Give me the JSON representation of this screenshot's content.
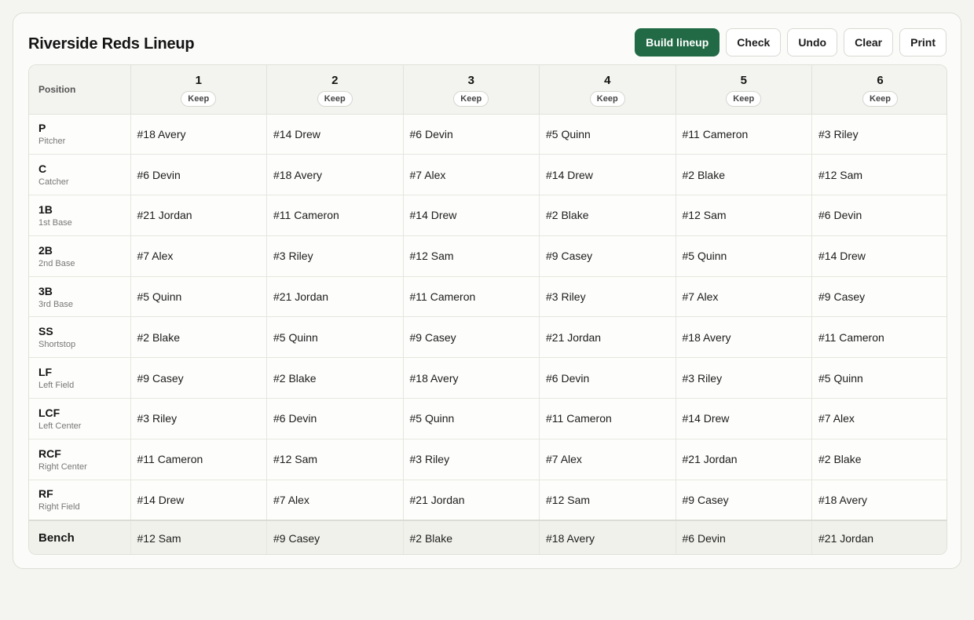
{
  "title": "Riverside Reds Lineup",
  "toolbar": {
    "build": "Build lineup",
    "check": "Check",
    "undo": "Undo",
    "clear": "Clear",
    "print": "Print"
  },
  "colors": {
    "accent": "#226a45",
    "background": "#f4f4f0"
  },
  "table": {
    "position_header": "Position",
    "keep_label": "Keep",
    "innings": [
      "1",
      "2",
      "3",
      "4",
      "5",
      "6"
    ],
    "rows": [
      {
        "code": "P",
        "name": "Pitcher",
        "players": [
          "#18 Avery",
          "#14 Drew",
          "#6 Devin",
          "#5 Quinn",
          "#11 Cameron",
          "#3 Riley"
        ]
      },
      {
        "code": "C",
        "name": "Catcher",
        "players": [
          "#6 Devin",
          "#18 Avery",
          "#7 Alex",
          "#14 Drew",
          "#2 Blake",
          "#12 Sam"
        ]
      },
      {
        "code": "1B",
        "name": "1st Base",
        "players": [
          "#21 Jordan",
          "#11 Cameron",
          "#14 Drew",
          "#2 Blake",
          "#12 Sam",
          "#6 Devin"
        ]
      },
      {
        "code": "2B",
        "name": "2nd Base",
        "players": [
          "#7 Alex",
          "#3 Riley",
          "#12 Sam",
          "#9 Casey",
          "#5 Quinn",
          "#14 Drew"
        ]
      },
      {
        "code": "3B",
        "name": "3rd Base",
        "players": [
          "#5 Quinn",
          "#21 Jordan",
          "#11 Cameron",
          "#3 Riley",
          "#7 Alex",
          "#9 Casey"
        ]
      },
      {
        "code": "SS",
        "name": "Shortstop",
        "players": [
          "#2 Blake",
          "#5 Quinn",
          "#9 Casey",
          "#21 Jordan",
          "#18 Avery",
          "#11 Cameron"
        ]
      },
      {
        "code": "LF",
        "name": "Left Field",
        "players": [
          "#9 Casey",
          "#2 Blake",
          "#18 Avery",
          "#6 Devin",
          "#3 Riley",
          "#5 Quinn"
        ]
      },
      {
        "code": "LCF",
        "name": "Left Center",
        "players": [
          "#3 Riley",
          "#6 Devin",
          "#5 Quinn",
          "#11 Cameron",
          "#14 Drew",
          "#7 Alex"
        ]
      },
      {
        "code": "RCF",
        "name": "Right Center",
        "players": [
          "#11 Cameron",
          "#12 Sam",
          "#3 Riley",
          "#7 Alex",
          "#21 Jordan",
          "#2 Blake"
        ]
      },
      {
        "code": "RF",
        "name": "Right Field",
        "players": [
          "#14 Drew",
          "#7 Alex",
          "#21 Jordan",
          "#12 Sam",
          "#9 Casey",
          "#18 Avery"
        ]
      }
    ],
    "bench": {
      "label": "Bench",
      "players": [
        "#12 Sam",
        "#9 Casey",
        "#2 Blake",
        "#18 Avery",
        "#6 Devin",
        "#21 Jordan"
      ]
    }
  }
}
